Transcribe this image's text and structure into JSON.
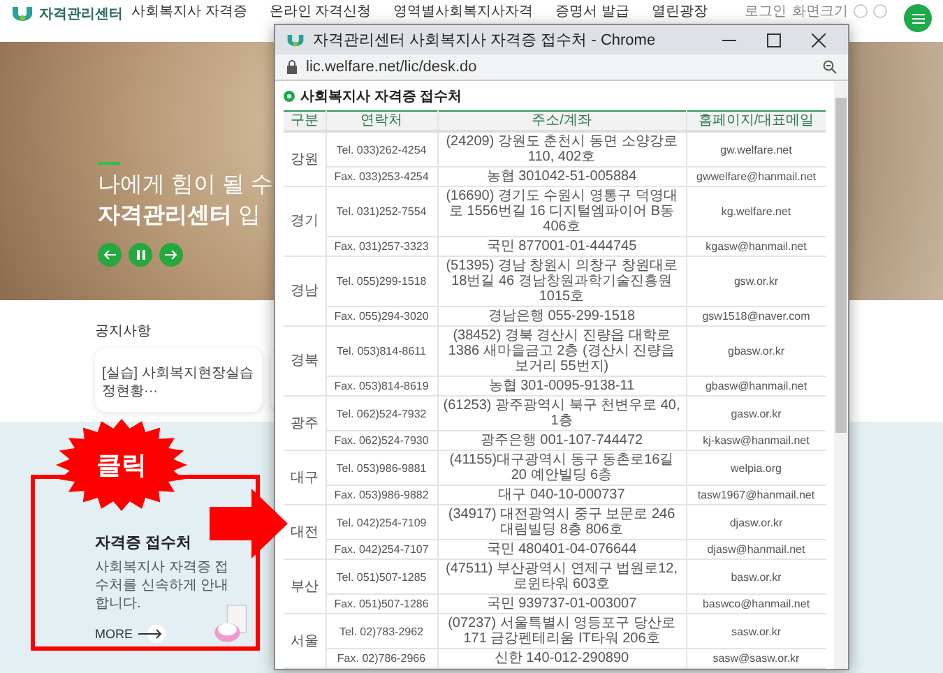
{
  "site_header": {
    "logo_text": "자격관리센터",
    "nav": [
      "사회복지사 자격증",
      "온라인 자격신청",
      "영역별사회복지사자격",
      "증명서 발급",
      "열린광장"
    ],
    "utility": [
      "로그인",
      "화면크기"
    ]
  },
  "hero": {
    "lines": [
      "나에게 힘이 될 수",
      "**자격관리센터** 입"
    ]
  },
  "notice": {
    "title": "공지사항",
    "card_lines": [
      "[실습] 사회복지현장실습",
      "정현황···"
    ]
  },
  "desk_card": {
    "title": "자격증 접수처",
    "description": "사회복지사 자격증 접수처를 신속하게 안내합니다.",
    "more": "MORE"
  },
  "callout": {
    "label": "클릭"
  },
  "popup": {
    "title": "자격관리센터 사회복지사 자격증 접수처 - Chrome",
    "url": "lic.welfare.net/lic/desk.do",
    "heading": "사회복지사 자격증 접수처",
    "columns": [
      "구분",
      "연락처",
      "주소/계좌",
      "홈페이지/대표메일"
    ],
    "regions": [
      {
        "name": "강원",
        "rows": [
          {
            "contact": "Tel. 033)262-4254",
            "address": "(24209) 강원도 춘천시 동면 소양강로110, 402호",
            "homepage": "gw.welfare.net"
          },
          {
            "contact": "Fax. 033)253-4254",
            "address": "농협 301042-51-005884",
            "homepage": "gwwelfare@hanmail.net"
          }
        ]
      },
      {
        "name": "경기",
        "rows": [
          {
            "contact": "Tel. 031)252-7554",
            "address": "(16690) 경기도 수원시 영통구 덕영대로 1556번길 16 디지털엠파이어 B동 406호",
            "homepage": "kg.welfare.net"
          },
          {
            "contact": "Fax. 031)257-3323",
            "address": "국민 877001-01-444745",
            "homepage": "kgasw@hanmail.net"
          }
        ]
      },
      {
        "name": "경남",
        "rows": [
          {
            "contact": "Tel. 055)299-1518",
            "address": "(51395) 경남 창원시 의창구 창원대로 18번길 46 경남창원과학기술진흥원 1015호",
            "homepage": "gsw.or.kr"
          },
          {
            "contact": "Fax. 055)294-3020",
            "address": "경남은행 055-299-1518",
            "homepage": "gsw1518@naver.com"
          }
        ]
      },
      {
        "name": "경북",
        "rows": [
          {
            "contact": "Tel. 053)814-8611",
            "address": "(38452) 경북 경산시 진량읍 대학로 1386 새마을금고 2층 (경산시 진량읍 보거리 55번지)",
            "homepage": "gbasw.or.kr"
          },
          {
            "contact": "Fax. 053)814-8619",
            "address": "농협 301-0095-9138-11",
            "homepage": "gbasw@hanmail.net"
          }
        ]
      },
      {
        "name": "광주",
        "rows": [
          {
            "contact": "Tel. 062)524-7932",
            "address": "(61253) 광주광역시 북구 천변우로 40, 1층",
            "homepage": "gasw.or.kr"
          },
          {
            "contact": "Fax. 062)524-7930",
            "address": "광주은행 001-107-744472",
            "homepage": "kj-kasw@hanmail.net"
          }
        ]
      },
      {
        "name": "대구",
        "rows": [
          {
            "contact": "Tel. 053)986-9881",
            "address": "(41155)대구광역시 동구 동촌로16길 20 예안빌딩 6층",
            "homepage": "welpia.org"
          },
          {
            "contact": "Fax. 053)986-9882",
            "address": "대구 040-10-000737",
            "homepage": "tasw1967@hanmail.net"
          }
        ]
      },
      {
        "name": "대전",
        "rows": [
          {
            "contact": "Tel. 042)254-7109",
            "address": "(34917) 대전광역시 중구 보문로 246 대림빌딩 8층 806호",
            "homepage": "djasw.or.kr"
          },
          {
            "contact": "Fax. 042)254-7107",
            "address": "국민 480401-04-076644",
            "homepage": "djasw@hanmail.net"
          }
        ]
      },
      {
        "name": "부산",
        "rows": [
          {
            "contact": "Tel. 051)507-1285",
            "address": "(47511) 부산광역시 연제구 법원로12, 로윈타워 603호",
            "homepage": "basw.or.kr"
          },
          {
            "contact": "Fax. 051)507-1286",
            "address": "국민 939737-01-003007",
            "homepage": "baswco@hanmail.net"
          }
        ]
      },
      {
        "name": "서울",
        "rows": [
          {
            "contact": "Tel. 02)783-2962",
            "address": "(07237) 서울특별시 영등포구 당산로 171 금강펜테리움 IT타워 206호",
            "homepage": "sasw.or.kr"
          },
          {
            "contact": "Fax. 02)786-2966",
            "address": "신한 140-012-290890",
            "homepage": "sasw@sasw.or.kr"
          }
        ]
      }
    ]
  }
}
